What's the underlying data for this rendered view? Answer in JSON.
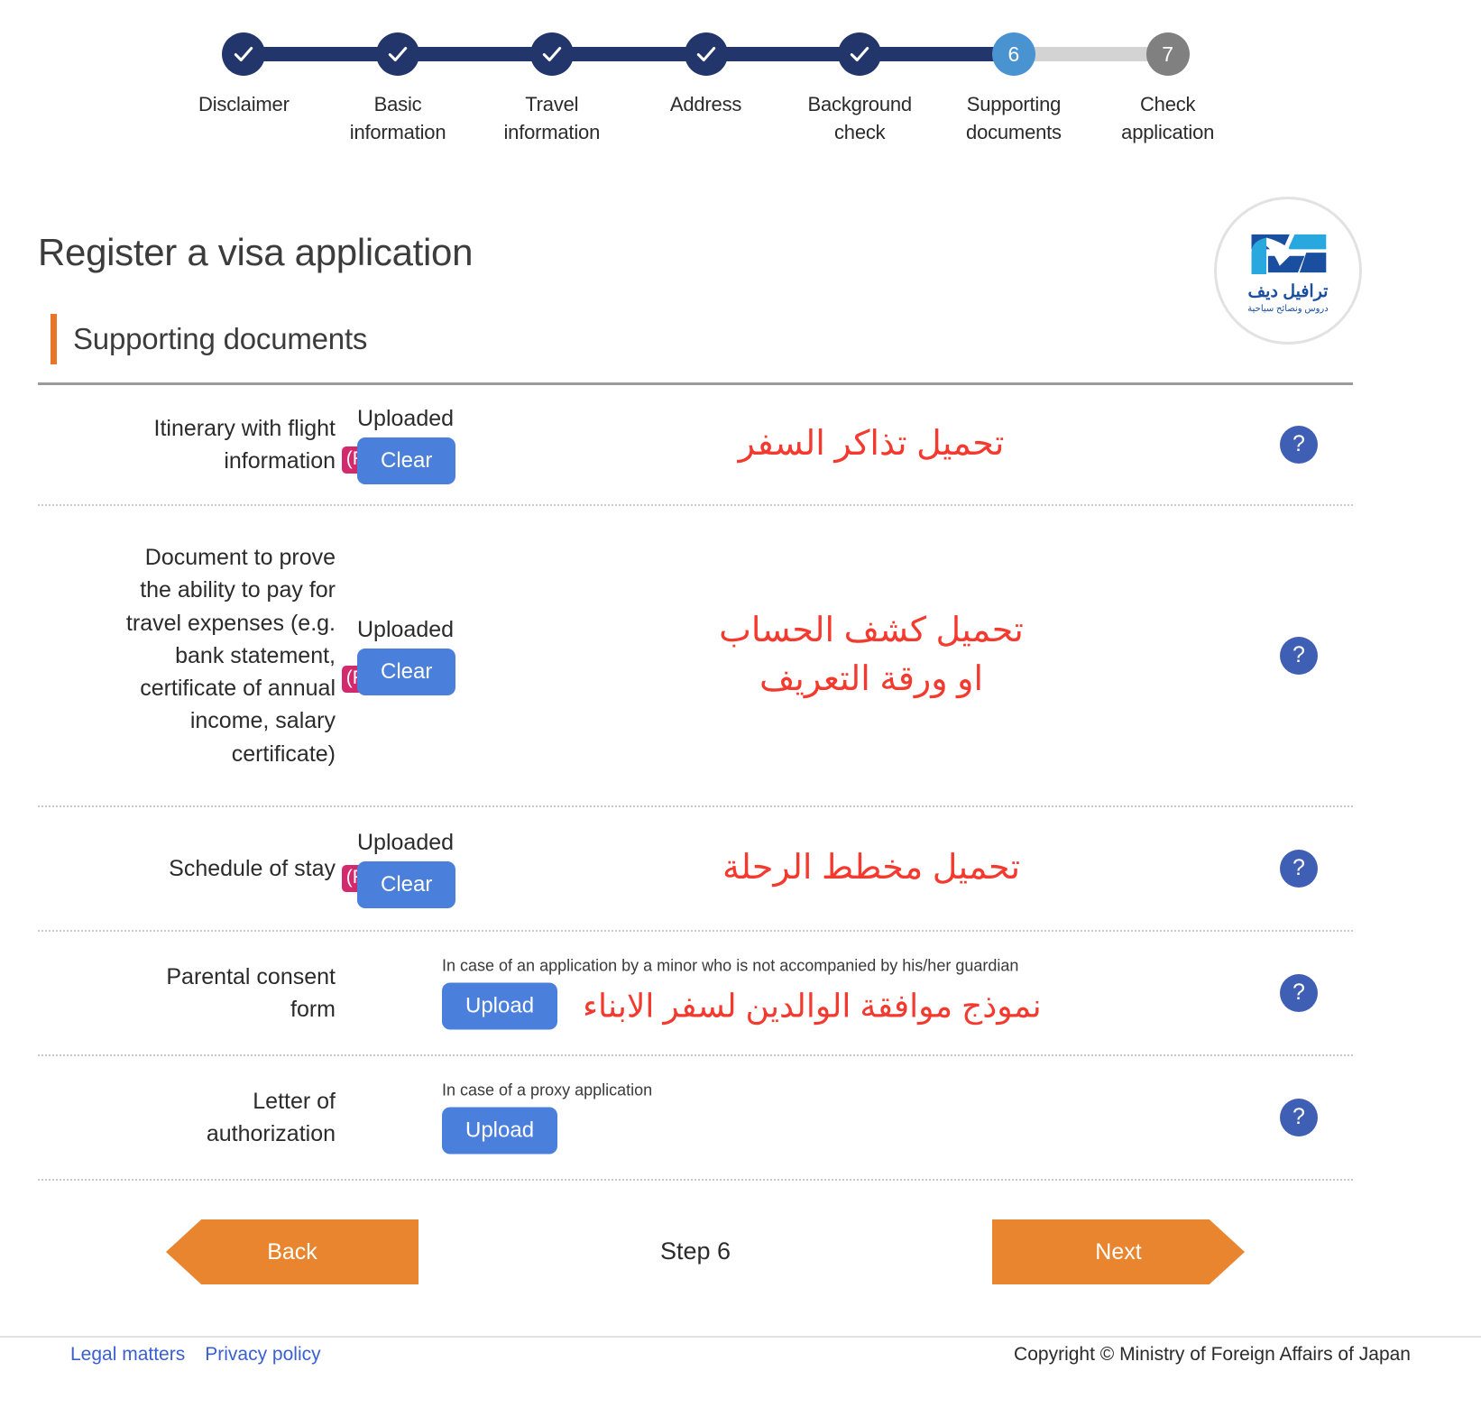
{
  "stepper": {
    "steps": [
      {
        "label": "Disclaimer",
        "state": "done",
        "marker": "check"
      },
      {
        "label": "Basic\ninformation",
        "state": "done",
        "marker": "check"
      },
      {
        "label": "Travel\ninformation",
        "state": "done",
        "marker": "check"
      },
      {
        "label": "Address",
        "state": "done",
        "marker": "check"
      },
      {
        "label": "Background\ncheck",
        "state": "done",
        "marker": "check"
      },
      {
        "label": "Supporting\ndocuments",
        "state": "current",
        "marker": "6"
      },
      {
        "label": "Check\napplication",
        "state": "future",
        "marker": "7"
      }
    ],
    "colors": {
      "done": "#23366b",
      "current": "#4a93d1",
      "future": "#808080",
      "track_todo": "#d3d3d3"
    }
  },
  "header": {
    "title": "Register a visa application"
  },
  "logo": {
    "arabic_name": "ترافيل ديف",
    "arabic_tagline": "دروس ونصائح سياحية",
    "brand_color": "#1a4fa0"
  },
  "section": {
    "title": "Supporting documents",
    "accent_color": "#e8762a"
  },
  "documents": [
    {
      "name": "Itinerary with flight\ninformation",
      "required_badge": "(Required)",
      "status": "Uploaded",
      "action_label": "Clear",
      "hint": "",
      "note_arabic": "تحميل تذاكر السفر",
      "help": "?"
    },
    {
      "name": "Document to prove\nthe ability to pay for\ntravel expenses (e.g.\nbank statement,\ncertificate of annual\nincome, salary\ncertificate)",
      "required_badge": "(Required)",
      "status": "Uploaded",
      "action_label": "Clear",
      "hint": "",
      "note_arabic": "تحميل كشف الحساب\nاو ورقة التعريف",
      "help": "?"
    },
    {
      "name": "Schedule of stay",
      "required_badge": "(Required)",
      "status": "Uploaded",
      "action_label": "Clear",
      "hint": "",
      "note_arabic": "تحميل مخطط الرحلة",
      "help": "?"
    },
    {
      "name": "Parental consent\nform",
      "required_badge": "",
      "status": "",
      "action_label": "Upload",
      "hint": "In case of an application by a minor who is not accompanied by his/her guardian",
      "note_arabic": "نموذج موافقة الوالدين لسفر الابناء",
      "help": "?"
    },
    {
      "name": "Letter of\nauthorization",
      "required_badge": "",
      "status": "",
      "action_label": "Upload",
      "hint": "In case of a proxy application",
      "note_arabic": "",
      "help": "?"
    }
  ],
  "navigation": {
    "back_label": "Back",
    "next_label": "Next",
    "step_counter": "Step 6",
    "button_color": "#e8852e"
  },
  "footer": {
    "links": [
      {
        "label": "Legal matters"
      },
      {
        "label": "Privacy policy"
      }
    ],
    "copyright": "Copyright © Ministry of Foreign Affairs of Japan"
  },
  "colors": {
    "required_badge": "#d32a6e",
    "primary_button": "#4a7fdc",
    "help_button": "#3f5fb5",
    "note_red": "#f4392f"
  }
}
